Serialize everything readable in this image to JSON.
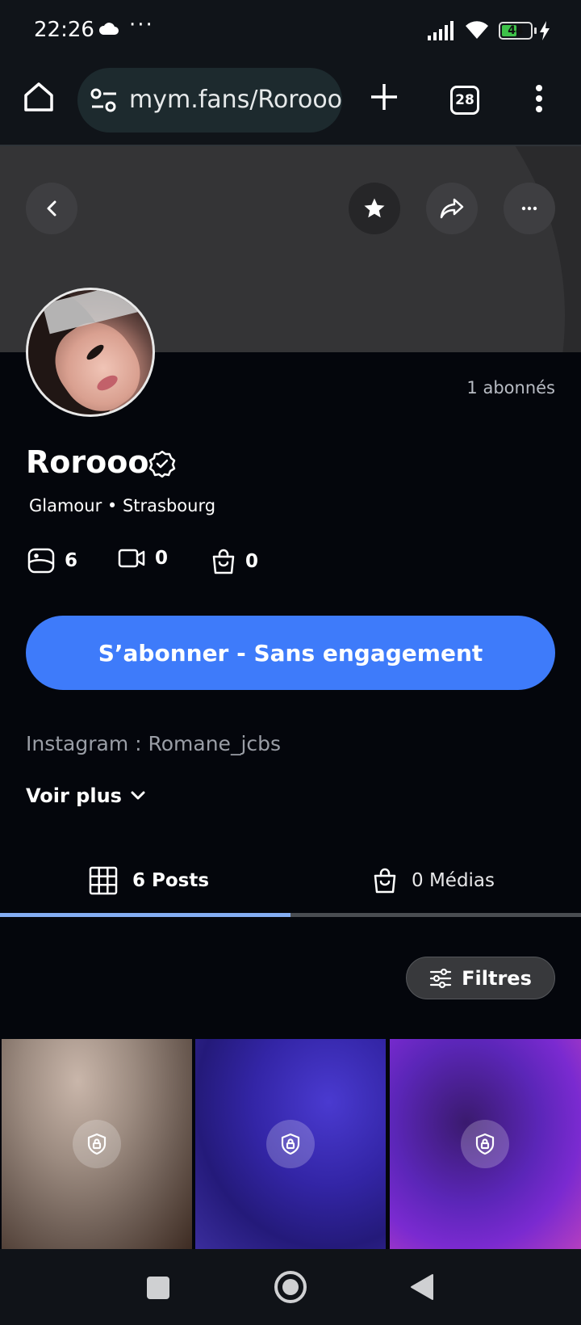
{
  "status_bar": {
    "time": "22:26",
    "dots": "···",
    "battery": "44"
  },
  "browser": {
    "url": "mym.fans/Rorooo",
    "tab_count": "28"
  },
  "profile": {
    "subscribers": "1 abonnés",
    "name": "Rorooo",
    "tagline": "Glamour • Strasbourg",
    "stats": {
      "posts_icon_count": "6",
      "videos_count": "0",
      "shop_count": "0"
    },
    "subscribe_label": "S’abonner - Sans engagement",
    "bio": "Instagram : Romane_jcbs",
    "see_more": "Voir plus"
  },
  "tabs": [
    {
      "label": "6 Posts",
      "active": true
    },
    {
      "label": "0 Médias",
      "active": false
    }
  ],
  "filters_label": "Filtres",
  "colors": {
    "accent": "#3e7bfa",
    "tab_indicator": "#84adf3",
    "background": "#04060c"
  },
  "icons": [
    "home-icon",
    "tune-icon",
    "plus-icon",
    "tabs-icon",
    "kebab-menu-icon",
    "back-icon",
    "star-icon",
    "share-icon",
    "more-icon",
    "verified-icon",
    "image-icon",
    "video-icon",
    "bag-icon",
    "chevron-down-icon",
    "grid-icon",
    "sliders-icon",
    "lock-icon"
  ]
}
